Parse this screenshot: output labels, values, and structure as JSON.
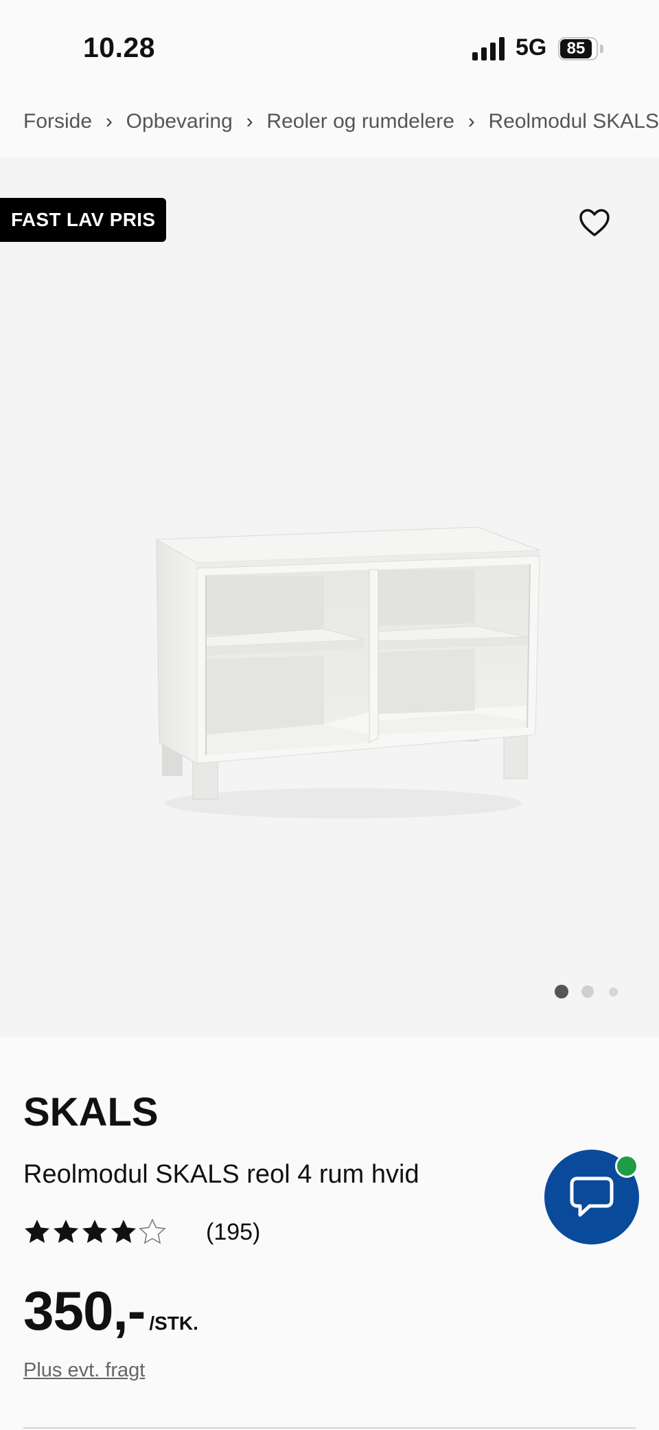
{
  "status_bar": {
    "time": "10.28",
    "network": "5G",
    "battery": "85"
  },
  "breadcrumb": [
    {
      "label": "Forside"
    },
    {
      "label": "Opbevaring"
    },
    {
      "label": "Reoler og rumdelere"
    },
    {
      "label": "Reolmodul SKALS"
    }
  ],
  "gallery": {
    "badge": "FAST LAV PRIS",
    "favorite_icon": "heart-outline-icon",
    "image_count": 3,
    "active_image": 1
  },
  "product": {
    "brand": "SKALS",
    "title": "Reolmodul SKALS reol 4 rum hvid",
    "rating_value": 4.5,
    "rating_max": 5,
    "review_count": "(195)",
    "price": "350,-",
    "price_unit": "/STK.",
    "shipping_link": "Plus evt. fragt"
  },
  "chat": {
    "icon": "chat-bubble-icon",
    "online_indicator_color": "#1f9c45",
    "button_color": "#0a4a9a"
  }
}
